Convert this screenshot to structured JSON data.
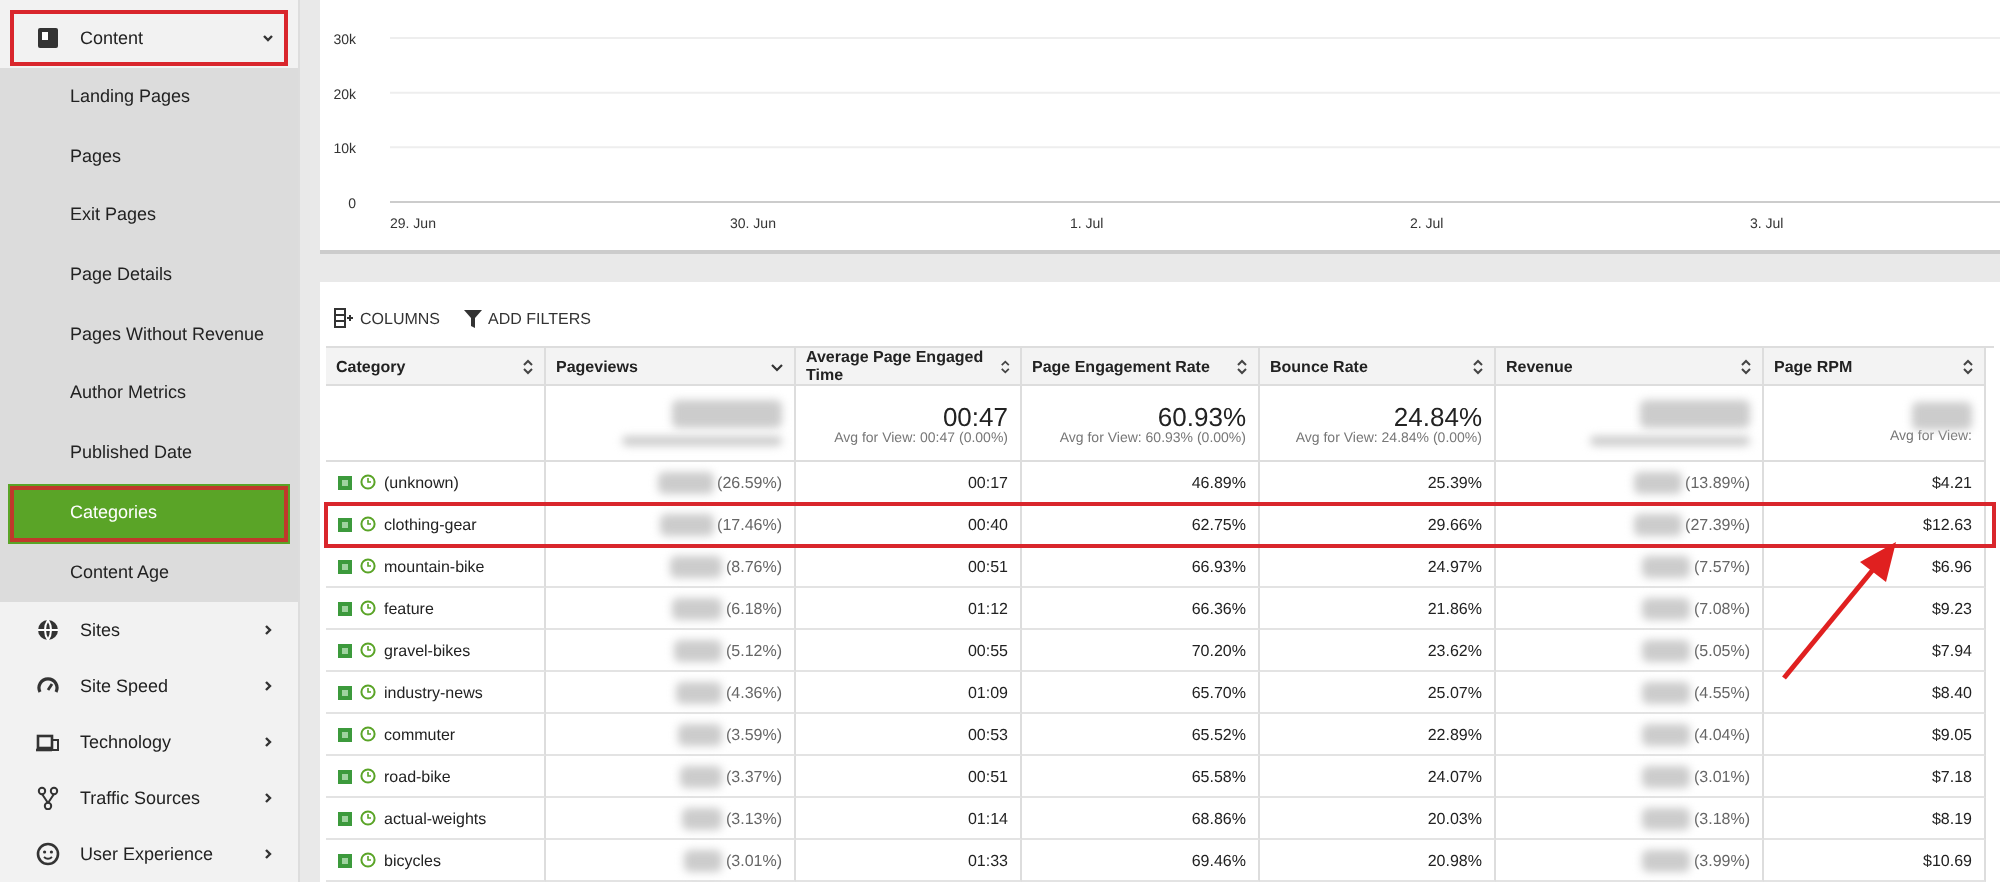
{
  "sidebar": {
    "sections": [
      {
        "label": "Content",
        "expanded": true,
        "highlighted": true,
        "children": [
          {
            "label": "Landing Pages",
            "selected": false
          },
          {
            "label": "Pages",
            "selected": false
          },
          {
            "label": "Exit Pages",
            "selected": false
          },
          {
            "label": "Page Details",
            "selected": false
          },
          {
            "label": "Pages Without Revenue",
            "selected": false
          },
          {
            "label": "Author Metrics",
            "selected": false
          },
          {
            "label": "Published Date",
            "selected": false
          },
          {
            "label": "Categories",
            "selected": true,
            "highlighted": true
          },
          {
            "label": "Content Age",
            "selected": false
          }
        ]
      },
      {
        "label": "Sites",
        "expanded": false,
        "highlighted": false
      },
      {
        "label": "Site Speed",
        "expanded": false,
        "highlighted": false
      },
      {
        "label": "Technology",
        "expanded": false,
        "highlighted": false
      },
      {
        "label": "Traffic Sources",
        "expanded": false,
        "highlighted": false
      },
      {
        "label": "User Experience",
        "expanded": false,
        "highlighted": false
      }
    ]
  },
  "chart": {
    "chart_data": {
      "type": "line",
      "categories": [
        "29. Jun",
        "30. Jun",
        "1. Jul",
        "2. Jul",
        "3. Jul"
      ],
      "ylim": [
        0,
        30000
      ],
      "yticks": [
        {
          "value": 0,
          "label": "0"
        },
        {
          "value": 10000,
          "label": "10k"
        },
        {
          "value": 20000,
          "label": "20k"
        },
        {
          "value": 30000,
          "label": "30k"
        }
      ]
    }
  },
  "toolbar": {
    "columns_button": "COLUMNS",
    "filters_button": "ADD FILTERS"
  },
  "table": {
    "columns": [
      {
        "label": "Category",
        "sorted": false
      },
      {
        "label": "Pageviews",
        "sorted": true
      },
      {
        "label": "Average Page Engaged Time",
        "sorted": false
      },
      {
        "label": "Page Engagement Rate",
        "sorted": false
      },
      {
        "label": "Bounce Rate",
        "sorted": false
      },
      {
        "label": "Revenue",
        "sorted": false
      },
      {
        "label": "Page RPM",
        "sorted": false
      }
    ],
    "summary": [
      {
        "kind": "empty"
      },
      {
        "kind": "blurred"
      },
      {
        "kind": "value",
        "value": "00:47",
        "note": "Avg for View: 00:47 (0.00%)"
      },
      {
        "kind": "value",
        "value": "60.93%",
        "note": "Avg for View: 60.93% (0.00%)"
      },
      {
        "kind": "value",
        "value": "24.84%",
        "note": "Avg for View: 24.84% (0.00%)"
      },
      {
        "kind": "blurred"
      },
      {
        "kind": "partial",
        "note": "Avg for View:"
      }
    ],
    "rows": [
      {
        "category": "(unknown)",
        "pageviews_share": "(26.59%)",
        "time": "00:17",
        "engagement": "46.89%",
        "bounce": "25.39%",
        "revenue_share": "(13.89%)",
        "rpm": "$4.21",
        "highlighted": false
      },
      {
        "category": "clothing-gear",
        "pageviews_share": "(17.46%)",
        "time": "00:40",
        "engagement": "62.75%",
        "bounce": "29.66%",
        "revenue_share": "(27.39%)",
        "rpm": "$12.63",
        "highlighted": true
      },
      {
        "category": "mountain-bike",
        "pageviews_share": "(8.76%)",
        "time": "00:51",
        "engagement": "66.93%",
        "bounce": "24.97%",
        "revenue_share": "(7.57%)",
        "rpm": "$6.96",
        "highlighted": false
      },
      {
        "category": "feature",
        "pageviews_share": "(6.18%)",
        "time": "01:12",
        "engagement": "66.36%",
        "bounce": "21.86%",
        "revenue_share": "(7.08%)",
        "rpm": "$9.23",
        "highlighted": false
      },
      {
        "category": "gravel-bikes",
        "pageviews_share": "(5.12%)",
        "time": "00:55",
        "engagement": "70.20%",
        "bounce": "23.62%",
        "revenue_share": "(5.05%)",
        "rpm": "$7.94",
        "highlighted": false
      },
      {
        "category": "industry-news",
        "pageviews_share": "(4.36%)",
        "time": "01:09",
        "engagement": "65.70%",
        "bounce": "25.07%",
        "revenue_share": "(4.55%)",
        "rpm": "$8.40",
        "highlighted": false
      },
      {
        "category": "commuter",
        "pageviews_share": "(3.59%)",
        "time": "00:53",
        "engagement": "65.52%",
        "bounce": "22.89%",
        "revenue_share": "(4.04%)",
        "rpm": "$9.05",
        "highlighted": false
      },
      {
        "category": "road-bike",
        "pageviews_share": "(3.37%)",
        "time": "00:51",
        "engagement": "65.58%",
        "bounce": "24.07%",
        "revenue_share": "(3.01%)",
        "rpm": "$7.18",
        "highlighted": false
      },
      {
        "category": "actual-weights",
        "pageviews_share": "(3.13%)",
        "time": "01:14",
        "engagement": "68.86%",
        "bounce": "20.03%",
        "revenue_share": "(3.18%)",
        "rpm": "$8.19",
        "highlighted": false
      },
      {
        "category": "bicycles",
        "pageviews_share": "(3.01%)",
        "time": "01:33",
        "engagement": "69.46%",
        "bounce": "20.98%",
        "revenue_share": "(3.99%)",
        "rpm": "$10.69",
        "highlighted": false
      }
    ]
  }
}
